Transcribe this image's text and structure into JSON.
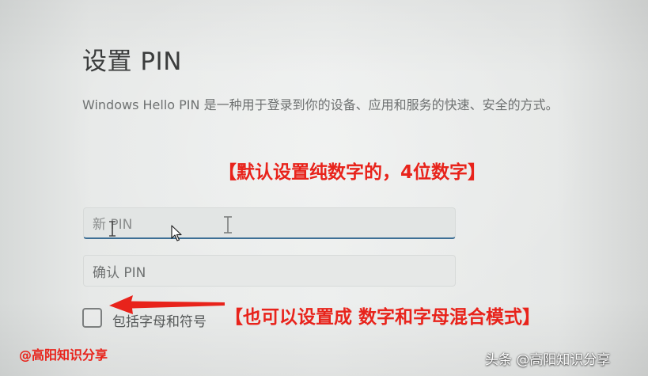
{
  "page": {
    "title": "设置 PIN",
    "description": "Windows Hello PIN 是一种用于登录到你的设备、应用和服务的快速、安全的方式。"
  },
  "form": {
    "new_pin_placeholder": "新 PIN",
    "confirm_pin_placeholder": "确认 PIN",
    "include_letters_label": "包括字母和符号",
    "include_letters_checked": false
  },
  "annotations": {
    "default_note": "【默认设置纯数字的，4位数字】",
    "mixed_note": "【也可以设置成 数字和字母混合模式】",
    "color": "#e8231b"
  },
  "watermarks": {
    "left": "@高阳知识分享",
    "right": "头条 @高阳知识分享"
  },
  "icons": {
    "text_cursor": "i-beam-cursor-icon",
    "mouse": "mouse-pointer-icon",
    "arrow": "red-arrow-icon"
  },
  "colors": {
    "focus_underline": "#3d6f95",
    "text_primary": "#3a3c3c"
  }
}
